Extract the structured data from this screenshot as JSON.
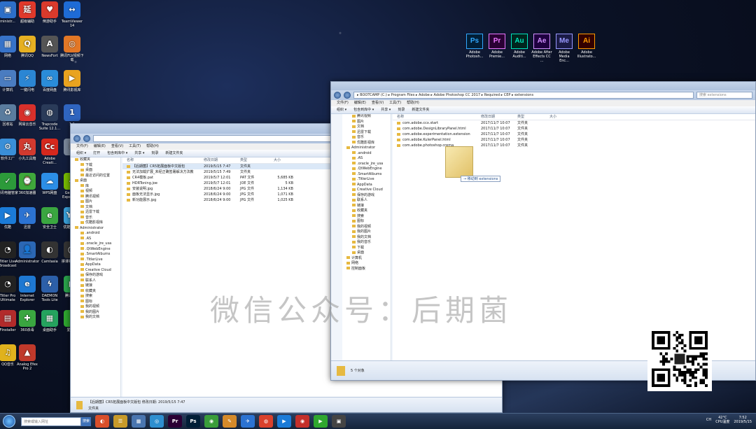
{
  "desktop": {
    "left_icons": [
      {
        "label": "ministr...",
        "color": "#2d6fc9",
        "glyph": "▣"
      },
      {
        "label": "超级辅助",
        "color": "#e0392b",
        "glyph": "延"
      },
      {
        "label": "倒游助手",
        "color": "#d93a2c",
        "glyph": "♥"
      },
      {
        "label": "TeamViewer 14",
        "color": "#1e6bd6",
        "glyph": "↔"
      },
      {
        "label": "网络",
        "color": "#3773c9",
        "glyph": "▦"
      },
      {
        "label": "腾讯QQ",
        "color": "#e6b022",
        "glyph": "Q"
      },
      {
        "label": "NewsFort",
        "color": "#555",
        "glyph": "A"
      },
      {
        "label": "腾讯FLV视频下载",
        "color": "#e27726",
        "glyph": "◎"
      },
      {
        "label": "计算机",
        "color": "#4a7cc0",
        "glyph": "▭"
      },
      {
        "label": "一键闪电",
        "color": "#2b86d4",
        "glyph": "⚡"
      },
      {
        "label": "百度网盘",
        "color": "#2a8cd9",
        "glyph": "∞"
      },
      {
        "label": "腾讯影视库",
        "color": "#e9a31f",
        "glyph": "▶"
      },
      {
        "label": "回收站",
        "color": "#5a7c9e",
        "glyph": "♻"
      },
      {
        "label": "网易云音乐",
        "color": "#d8302b",
        "glyph": "◉"
      },
      {
        "label": "Trapcode Suite 12.1...",
        "color": "#2a3b59",
        "glyph": "◍"
      },
      {
        "label": "1.1",
        "color": "#2f65c0",
        "glyph": "1"
      },
      {
        "label": "软件工厂",
        "color": "#3a8fd8",
        "glyph": "⚙"
      },
      {
        "label": "小丸工具箱",
        "color": "#d23a2f",
        "glyph": "丸"
      },
      {
        "label": "Adobe Creati...",
        "color": "#d6281d",
        "glyph": "Cc"
      },
      {
        "label": "R",
        "color": "#7a8799",
        "glyph": "R"
      },
      {
        "label": "腾讯电脑管家",
        "color": "#2c9a3a",
        "glyph": "✓"
      },
      {
        "label": "360加速器",
        "color": "#3fa83b",
        "glyph": "⌚"
      },
      {
        "label": "WPS网盘",
        "color": "#2c8ee6",
        "glyph": "☁"
      },
      {
        "label": "GeForce Experience",
        "color": "#76b900",
        "glyph": "◆"
      },
      {
        "label": "优酷",
        "color": "#1b7bd8",
        "glyph": "▶"
      },
      {
        "label": "迅雷",
        "color": "#2c73d2",
        "glyph": "✈"
      },
      {
        "label": "安全卫士",
        "color": "#3aa640",
        "glyph": "e"
      },
      {
        "label": "优酷视频库",
        "color": "#3a9fd8",
        "glyph": "YK"
      },
      {
        "label": "Titler Live Broadcast",
        "color": "#222",
        "glyph": "◔"
      },
      {
        "label": "Administrator",
        "color": "#2b67b4",
        "glyph": "👤"
      },
      {
        "label": "Camtasia",
        "color": "#333",
        "glyph": "◐"
      },
      {
        "label": "拼课社直播精灵",
        "color": "#333",
        "glyph": "◯"
      },
      {
        "label": "Titler Pro Ultimate",
        "color": "#222",
        "glyph": "◔"
      },
      {
        "label": "Internet Explorer",
        "color": "#1e78d2",
        "glyph": "e"
      },
      {
        "label": "DAEMON Tools Lite",
        "color": "#2c5fa8",
        "glyph": "ϟ"
      },
      {
        "label": "腾讯视频",
        "color": "#2aa24a",
        "glyph": "▶"
      },
      {
        "label": "FInstaller",
        "color": "#b22b2b",
        "glyph": "▤"
      },
      {
        "label": "360杀毒",
        "color": "#3aa640",
        "glyph": "✚"
      },
      {
        "label": "桌面助手",
        "color": "#25a35e",
        "glyph": "▦"
      },
      {
        "label": "爱奇艺",
        "color": "#2fa72f",
        "glyph": "i"
      },
      {
        "label": "QQ音乐",
        "color": "#e0b21d",
        "glyph": "♫"
      },
      {
        "label": "Analog Efex Pro 2",
        "color": "#c0392b",
        "glyph": "▲"
      }
    ],
    "adobe_icons": [
      {
        "abbr": "Ps",
        "label": "Adobe Photosh...",
        "color": "#31a8ff",
        "bg": "#001e36"
      },
      {
        "abbr": "Pr",
        "label": "Adobe Premie...",
        "color": "#ea77ff",
        "bg": "#2a0034"
      },
      {
        "abbr": "Au",
        "label": "Adobe Auditi...",
        "color": "#00e4bb",
        "bg": "#00251e"
      },
      {
        "abbr": "Ae",
        "label": "Adobe After Effects CC ...",
        "color": "#d291ff",
        "bg": "#1f0040"
      },
      {
        "abbr": "Me",
        "label": "Adobe Media Enc...",
        "color": "#9999ff",
        "bg": "#1b1b46"
      },
      {
        "abbr": "Ai",
        "label": "Adobe Illustrato...",
        "color": "#ff9a00",
        "bg": "#330000"
      }
    ]
  },
  "window_left": {
    "address": "",
    "menu": [
      "文件(F)",
      "编辑(E)",
      "查看(V)",
      "工具(T)",
      "帮助(H)"
    ],
    "toolbar": [
      "组织 ▾",
      "打开",
      "包含到库中 ▾",
      "共享 ▾",
      "刻录",
      "新建文件夹"
    ],
    "nav": [
      {
        "label": "收藏夹",
        "lvl": 0
      },
      {
        "label": "下载",
        "lvl": 1
      },
      {
        "label": "桌面",
        "lvl": 1
      },
      {
        "label": "最近访问的位置",
        "lvl": 1
      },
      {
        "label": "桌面",
        "lvl": 0
      },
      {
        "label": "库",
        "lvl": 1
      },
      {
        "label": "视频",
        "lvl": 1
      },
      {
        "label": "腾讯视频",
        "lvl": 1
      },
      {
        "label": "图片",
        "lvl": 1
      },
      {
        "label": "文档",
        "lvl": 1
      },
      {
        "label": "迅雷下载",
        "lvl": 1
      },
      {
        "label": "音乐",
        "lvl": 1
      },
      {
        "label": "优酷影视库",
        "lvl": 1
      },
      {
        "label": "Administrator",
        "lvl": 0
      },
      {
        "label": ".android",
        "lvl": 1
      },
      {
        "label": ".AS",
        "lvl": 1
      },
      {
        "label": ".oracle_jre_usa",
        "lvl": 1
      },
      {
        "label": ".QtWebEngine",
        "lvl": 1
      },
      {
        "label": ".SmartAlbums",
        "lvl": 1
      },
      {
        "label": ".TitlerLive",
        "lvl": 1
      },
      {
        "label": "AppData",
        "lvl": 1
      },
      {
        "label": "Creative Cloud",
        "lvl": 1
      },
      {
        "label": "保存的游戏",
        "lvl": 1
      },
      {
        "label": "联系人",
        "lvl": 1
      },
      {
        "label": "链接",
        "lvl": 1
      },
      {
        "label": "收藏夹",
        "lvl": 1
      },
      {
        "label": "搜索",
        "lvl": 1
      },
      {
        "label": "图标",
        "lvl": 1
      },
      {
        "label": "我的视频",
        "lvl": 1
      },
      {
        "label": "我的图片",
        "lvl": 1
      },
      {
        "label": "我的文档",
        "lvl": 1
      }
    ],
    "columns": [
      "名称",
      "修改日期",
      "类型",
      "大小"
    ],
    "rows": [
      {
        "name": "【后期菌】CR5拓展面板中文版包",
        "date": "2019/5/15 7:47",
        "type": "文件夹",
        "size": "",
        "sel": true
      },
      {
        "name": "无法加载扩展_未经正确签署解决方法教",
        "date": "2019/5/15 7:49",
        "type": "文件夹",
        "size": "",
        "sel": false
      },
      {
        "name": "CR4模板.pat",
        "date": "2019/5/7 12:01",
        "type": "PAT 文件",
        "size": "5,685 KB",
        "sel": false
      },
      {
        "name": "HDRToning.joe",
        "date": "2019/5/7 12:01",
        "type": "JOE 文件",
        "size": "5 KB",
        "sel": false
      },
      {
        "name": "安装说明.jpg",
        "date": "2018/6/24 9:00",
        "type": "JPG 文件",
        "size": "1,134 KB",
        "sel": false
      },
      {
        "name": "面板无法显示.jpg",
        "date": "2018/6/24 9:00",
        "type": "JPG 文件",
        "size": "1,071 KB",
        "sel": false
      },
      {
        "name": "新功能展示.jpg",
        "date": "2018/6/24 9:00",
        "type": "JPG 文件",
        "size": "1,025 KB",
        "sel": false
      }
    ],
    "status": "【后期菌】CR5拓展面板中文版包  修改日期: 2019/5/15 7:47",
    "status_type": "文件夹"
  },
  "window_right": {
    "address": "▸ BOOTCAMP (C:) ▸ Program Files ▸ Adobe ▸ Adobe Photoshop CC 2017 ▸ Required ▸ CEP ▸ extensions",
    "search_placeholder": "搜索 extensions",
    "menu": [
      "文件(F)",
      "编辑(E)",
      "查看(V)",
      "工具(T)",
      "帮助(H)"
    ],
    "toolbar": [
      "组织 ▾",
      "包含到库中 ▾",
      "共享 ▾",
      "刻录",
      "新建文件夹"
    ],
    "nav": [
      {
        "label": "腾讯视频",
        "lvl": 1
      },
      {
        "label": "图片",
        "lvl": 1
      },
      {
        "label": "文档",
        "lvl": 1
      },
      {
        "label": "迅雷下载",
        "lvl": 1
      },
      {
        "label": "音乐",
        "lvl": 1
      },
      {
        "label": "优酷影视库",
        "lvl": 1
      },
      {
        "label": "Administrator",
        "lvl": 0
      },
      {
        "label": ".android",
        "lvl": 1
      },
      {
        "label": ".AS",
        "lvl": 1
      },
      {
        "label": ".oracle_jre_usa",
        "lvl": 1
      },
      {
        "label": ".QtWebEngine",
        "lvl": 1
      },
      {
        "label": ".SmartAlbums",
        "lvl": 1
      },
      {
        "label": ".TitlerLive",
        "lvl": 1
      },
      {
        "label": "AppData",
        "lvl": 1
      },
      {
        "label": "Creative Cloud",
        "lvl": 1
      },
      {
        "label": "保存的游戏",
        "lvl": 1
      },
      {
        "label": "联系人",
        "lvl": 1
      },
      {
        "label": "链接",
        "lvl": 1
      },
      {
        "label": "收藏夹",
        "lvl": 1
      },
      {
        "label": "搜索",
        "lvl": 1
      },
      {
        "label": "图标",
        "lvl": 1
      },
      {
        "label": "我的视频",
        "lvl": 1
      },
      {
        "label": "我的图片",
        "lvl": 1
      },
      {
        "label": "我的文档",
        "lvl": 1
      },
      {
        "label": "我的音乐",
        "lvl": 1
      },
      {
        "label": "下载",
        "lvl": 1
      },
      {
        "label": "桌面",
        "lvl": 1
      },
      {
        "label": "计算机",
        "lvl": 0
      },
      {
        "label": "网络",
        "lvl": 0
      },
      {
        "label": "控制面板",
        "lvl": 0
      }
    ],
    "columns": [
      "名称",
      "修改日期",
      "类型",
      "大小"
    ],
    "rows": [
      {
        "name": "com.adobe.ccx.start",
        "date": "2017/11/7 10:07",
        "type": "文件夹"
      },
      {
        "name": "com.adobe.DesignLibraryPanel.html",
        "date": "2017/11/7 10:07",
        "type": "文件夹"
      },
      {
        "name": "com.adobe.experimentation.extension",
        "date": "2017/11/7 10:07",
        "type": "文件夹"
      },
      {
        "name": "com.adobe.KulerPanel.html",
        "date": "2017/11/7 10:07",
        "type": "文件夹"
      },
      {
        "name": "com.adobe.photoshop.crema",
        "date": "2017/11/7 10:07",
        "type": "文件夹"
      }
    ],
    "drag_tip": "→ 移动到 extensions",
    "status": "5 个对象"
  },
  "watermark": "微信公众号：后期菌",
  "taskbar": {
    "search_placeholder": "搜索或输入网址",
    "search_button": "搜索",
    "apps": [
      {
        "glyph": "◐",
        "color": "#d94f2a"
      },
      {
        "glyph": "☰",
        "color": "#c79a2a"
      },
      {
        "glyph": "▦",
        "color": "#4a76b0"
      },
      {
        "glyph": "◎",
        "color": "#2e8fd0"
      },
      {
        "glyph": "Pr",
        "color": "#2a0034"
      },
      {
        "glyph": "Ps",
        "color": "#001e36"
      },
      {
        "glyph": "◉",
        "color": "#3a9d3a"
      },
      {
        "glyph": "✎",
        "color": "#d58a2a"
      },
      {
        "glyph": "✈",
        "color": "#2c73d2"
      },
      {
        "glyph": "◍",
        "color": "#d9412d"
      },
      {
        "glyph": "▶",
        "color": "#1b7bd8"
      },
      {
        "glyph": "◉",
        "color": "#c4302b"
      },
      {
        "glyph": "▶",
        "color": "#2fa72f"
      },
      {
        "glyph": "▣",
        "color": "#444"
      }
    ],
    "cpu_temp": "42°C",
    "cpu_label": "CPU温度",
    "time": "7:52",
    "date": "2019/5/15",
    "ime": "CH"
  }
}
